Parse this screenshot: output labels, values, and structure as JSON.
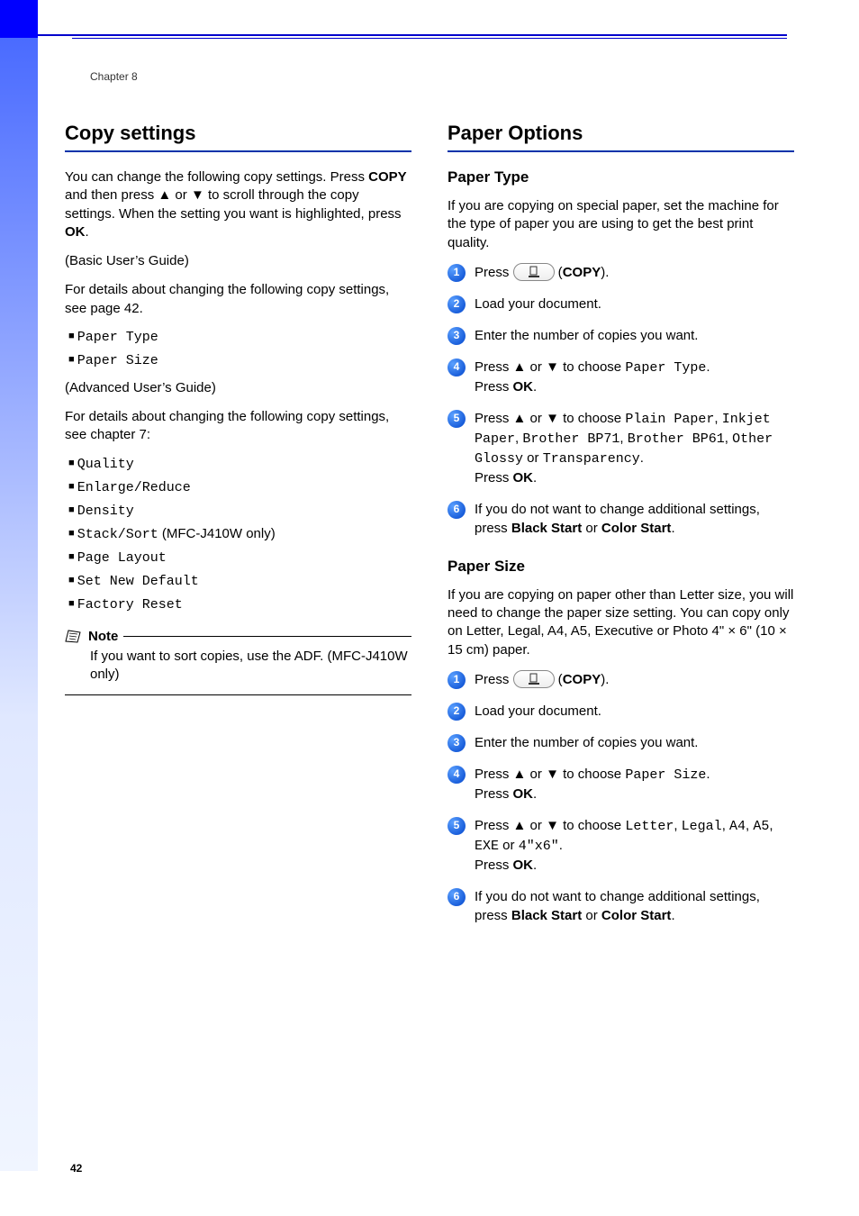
{
  "chapter": "Chapter 8",
  "page_number": "42",
  "left": {
    "heading": "Copy settings",
    "intro_parts": {
      "t1": "You can change the following copy settings. Press ",
      "b1": "COPY",
      "t2": " and then press ",
      "up": "▲",
      "t3": " or ",
      "down": "▼",
      "t4": " to scroll through the copy settings. When the setting you want is highlighted, press ",
      "b2": "OK",
      "t5": "."
    },
    "basic_guide": "(Basic User’s Guide)",
    "basic_detail": "For details about changing the following copy settings, see page 42.",
    "basic_list": [
      "Paper Type",
      "Paper Size"
    ],
    "adv_guide": "(Advanced User’s Guide)",
    "adv_detail": "For details about changing the following copy settings, see chapter 7:",
    "adv_list": [
      {
        "code": "Quality",
        "tail": ""
      },
      {
        "code": "Enlarge/Reduce",
        "tail": ""
      },
      {
        "code": "Density",
        "tail": ""
      },
      {
        "code": "Stack/Sort",
        "tail": " (MFC-J410W only)"
      },
      {
        "code": "Page Layout",
        "tail": ""
      },
      {
        "code": "Set New Default",
        "tail": ""
      },
      {
        "code": "Factory Reset",
        "tail": ""
      }
    ],
    "note_label": "Note",
    "note_body": "If you want to sort copies, use the ADF. (MFC-J410W only)"
  },
  "right": {
    "heading": "Paper Options",
    "paper_type": {
      "sub": "Paper Type",
      "intro": "If you are copying on special paper, set the machine for the type of paper you are using to get the best print quality.",
      "steps": {
        "s1": {
          "t1": "Press ",
          "t2": " (",
          "b1": "COPY",
          "t3": ")."
        },
        "s2": "Load your document.",
        "s3": "Enter the number of copies you want.",
        "s4": {
          "t1": "Press ",
          "up": "▲",
          "t2": " or ",
          "down": "▼",
          "t3": " to choose ",
          "c1": "Paper Type",
          "t4": ".",
          "t5": "Press ",
          "b1": "OK",
          "t6": "."
        },
        "s5": {
          "t1": "Press ",
          "up": "▲",
          "t2": " or ",
          "down": "▼",
          "t3": " to choose ",
          "c1": "Plain Paper",
          "t4": ", ",
          "c2": "Inkjet Paper",
          "t5": ", ",
          "c3": "Brother BP71",
          "t6": ", ",
          "c4": "Brother BP61",
          "t7": ", ",
          "c5": "Other Glossy",
          "t8": " or ",
          "c6": "Transparency",
          "t9": ".",
          "t10": "Press ",
          "b1": "OK",
          "t11": "."
        },
        "s6": {
          "t1": "If you do not want to change additional settings, press ",
          "b1": "Black Start",
          "t2": " or ",
          "b2": "Color Start",
          "t3": "."
        }
      }
    },
    "paper_size": {
      "sub": "Paper Size",
      "intro": "If you are copying on paper other than Letter size, you will need to change the paper size setting. You can copy only on Letter, Legal, A4, A5, Executive or Photo 4\" × 6\" (10 × 15 cm) paper.",
      "steps": {
        "s1": {
          "t1": "Press ",
          "t2": " (",
          "b1": "COPY",
          "t3": ")."
        },
        "s2": "Load your document.",
        "s3": "Enter the number of copies you want.",
        "s4": {
          "t1": "Press ",
          "up": "▲",
          "t2": " or ",
          "down": "▼",
          "t3": " to choose ",
          "c1": "Paper Size",
          "t4": ".",
          "t5": "Press ",
          "b1": "OK",
          "t6": "."
        },
        "s5": {
          "t1": "Press ",
          "up": "▲",
          "t2": " or ",
          "down": "▼",
          "t3": " to choose ",
          "c1": "Letter",
          "t4": ", ",
          "c2": "Legal",
          "t5": ", ",
          "c3": "A4",
          "t6": ", ",
          "c4": "A5",
          "t7": ", ",
          "c5": "EXE",
          "t8": " or ",
          "c6": "4\"x6\"",
          "t9": ".",
          "t10": "Press ",
          "b1": "OK",
          "t11": "."
        },
        "s6": {
          "t1": "If you do not want to change additional settings, press ",
          "b1": "Black Start",
          "t2": " or ",
          "b2": "Color Start",
          "t3": "."
        }
      }
    }
  }
}
